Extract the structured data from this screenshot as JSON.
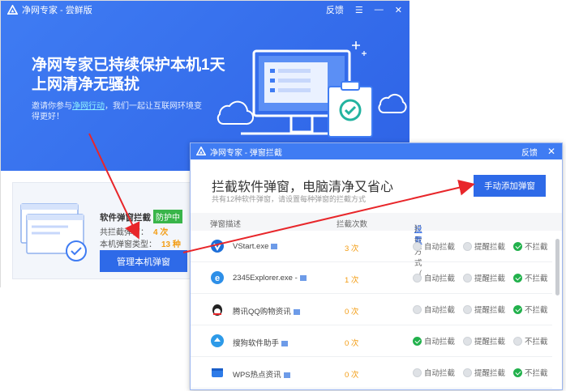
{
  "main": {
    "title": "净网专家 - 尝鲜版",
    "feedback": "反馈",
    "hero_title": "净网专家已持续保护本机1天上网清净无骚扰",
    "hero_desc_before": "邀请你参与",
    "hero_desc_link": "净网行动",
    "hero_desc_after": "，我们一起让互联网环境变得更好！",
    "stat_title": "软件弹窗拦截",
    "badge": "防护中",
    "blocked_label": "共拦截弹窗：",
    "blocked_count": "4 次",
    "types_label": "本机弹窗类型：",
    "types_count": "13 种",
    "manage_button": "管理本机弹窗"
  },
  "popup": {
    "title": "净网专家 - 弹窗拦截",
    "feedback": "反馈",
    "heading": "拦截软件弹窗，电脑清净又省心",
    "subtitle": "共有12种软件弹窗，请设置每种弹窗的拦截方式",
    "add_button": "手动添加弹窗",
    "col_desc": "弹窗描述",
    "col_count": "拦截次数",
    "col_method": "拦截方式（",
    "col_settings": "设置",
    "col_method_end": "）",
    "options": [
      "自动拦截",
      "提醒拦截",
      "不拦截"
    ],
    "rows": [
      {
        "name": "VStart.exe",
        "count": "3 次",
        "selected": 2,
        "icon": "vstart-icon"
      },
      {
        "name": "2345Explorer.exe -",
        "count": "1 次",
        "selected": 2,
        "icon": "ie-icon"
      },
      {
        "name": "腾讯QQ购物资讯",
        "count": "0 次",
        "selected": 2,
        "icon": "qq-icon"
      },
      {
        "name": "搜狗软件助手",
        "count": "0 次",
        "selected": 0,
        "icon": "sogou-icon"
      },
      {
        "name": "WPS热点资讯",
        "count": "0 次",
        "selected": 2,
        "icon": "wps-icon"
      }
    ]
  },
  "colors": {
    "brand": "#3f7cf3",
    "button": "#2e6ae8",
    "badge": "#39b54a",
    "accent_count": "#f39c12",
    "selected": "#22b14c",
    "arrow": "#e8262a"
  }
}
